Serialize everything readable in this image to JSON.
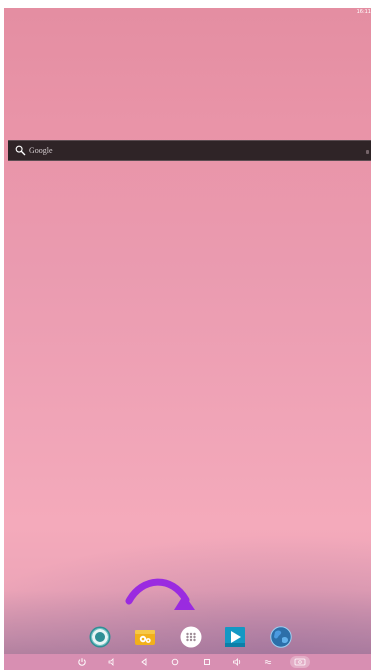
{
  "status_bar": {
    "time": "16:11"
  },
  "search_widget": {
    "label": "Google",
    "icon": "search-icon"
  },
  "dock": {
    "apps": [
      {
        "icon": "settings-icon"
      },
      {
        "icon": "files-icon"
      },
      {
        "icon": "app-drawer-icon"
      },
      {
        "icon": "play-icon"
      },
      {
        "icon": "browser-icon"
      }
    ]
  },
  "navigation_bar": {
    "buttons": [
      "power-icon",
      "volume-down-icon",
      "back-icon",
      "home-icon",
      "recent-apps-icon",
      "volume-up-icon",
      "menu-icon",
      "screenshot-icon"
    ]
  },
  "annotation": {
    "arrow_color": "#9a2be0"
  },
  "colors": {
    "wallpaper": "#ea9bb0",
    "search_bar": "#2f2427",
    "arrow": "#9a2be0",
    "settings_teal": "#2f8f95",
    "files_orange": "#f2b01a",
    "play_cyan": "#1498c4",
    "browser_blue": "#2c6fa9"
  }
}
